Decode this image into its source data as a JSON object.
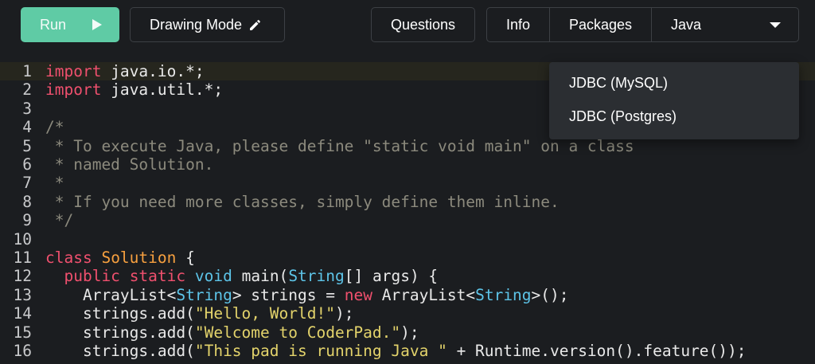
{
  "toolbar": {
    "run_label": "Run",
    "drawing_label": "Drawing Mode",
    "questions_label": "Questions",
    "info_label": "Info",
    "packages_label": "Packages",
    "language_label": "Java",
    "run_color": "#5fcba5"
  },
  "packages_menu": {
    "items": [
      "JDBC (MySQL)",
      "JDBC (Postgres)"
    ]
  },
  "editor": {
    "active_line": 1,
    "lines": [
      {
        "n": "1",
        "tokens": [
          {
            "t": "kw",
            "v": "import"
          },
          {
            "t": "p",
            "v": " java.io.*;"
          }
        ]
      },
      {
        "n": "2",
        "tokens": [
          {
            "t": "kw",
            "v": "import"
          },
          {
            "t": "p",
            "v": " java.util.*;"
          }
        ]
      },
      {
        "n": "3",
        "tokens": []
      },
      {
        "n": "4",
        "tokens": [
          {
            "t": "cm",
            "v": "/*"
          }
        ]
      },
      {
        "n": "5",
        "tokens": [
          {
            "t": "cm",
            "v": " * To execute Java, please define \"static void main\" on a class"
          }
        ]
      },
      {
        "n": "6",
        "tokens": [
          {
            "t": "cm",
            "v": " * named Solution."
          }
        ]
      },
      {
        "n": "7",
        "tokens": [
          {
            "t": "cm",
            "v": " *"
          }
        ]
      },
      {
        "n": "8",
        "tokens": [
          {
            "t": "cm",
            "v": " * If you need more classes, simply define them inline."
          }
        ]
      },
      {
        "n": "9",
        "tokens": [
          {
            "t": "cm",
            "v": " */"
          }
        ]
      },
      {
        "n": "10",
        "tokens": []
      },
      {
        "n": "11",
        "tokens": [
          {
            "t": "kw",
            "v": "class"
          },
          {
            "t": "p",
            "v": " "
          },
          {
            "t": "cls",
            "v": "Solution"
          },
          {
            "t": "p",
            "v": " {"
          }
        ]
      },
      {
        "n": "12",
        "tokens": [
          {
            "t": "p",
            "v": "  "
          },
          {
            "t": "kw",
            "v": "public"
          },
          {
            "t": "p",
            "v": " "
          },
          {
            "t": "kw",
            "v": "static"
          },
          {
            "t": "p",
            "v": " "
          },
          {
            "t": "typ",
            "v": "void"
          },
          {
            "t": "p",
            "v": " main("
          },
          {
            "t": "typ",
            "v": "String"
          },
          {
            "t": "p",
            "v": "[] args) {"
          }
        ]
      },
      {
        "n": "13",
        "tokens": [
          {
            "t": "p",
            "v": "    ArrayList<"
          },
          {
            "t": "typ",
            "v": "String"
          },
          {
            "t": "p",
            "v": "> strings = "
          },
          {
            "t": "kw",
            "v": "new"
          },
          {
            "t": "p",
            "v": " ArrayList<"
          },
          {
            "t": "typ",
            "v": "String"
          },
          {
            "t": "p",
            "v": ">();"
          }
        ]
      },
      {
        "n": "14",
        "tokens": [
          {
            "t": "p",
            "v": "    strings.add("
          },
          {
            "t": "str",
            "v": "\"Hello, World!\""
          },
          {
            "t": "p",
            "v": ");"
          }
        ]
      },
      {
        "n": "15",
        "tokens": [
          {
            "t": "p",
            "v": "    strings.add("
          },
          {
            "t": "str",
            "v": "\"Welcome to CoderPad.\""
          },
          {
            "t": "p",
            "v": ");"
          }
        ]
      },
      {
        "n": "16",
        "tokens": [
          {
            "t": "p",
            "v": "    strings.add("
          },
          {
            "t": "str",
            "v": "\"This pad is running Java \""
          },
          {
            "t": "p",
            "v": " + Runtime.version().feature());"
          }
        ]
      }
    ]
  }
}
